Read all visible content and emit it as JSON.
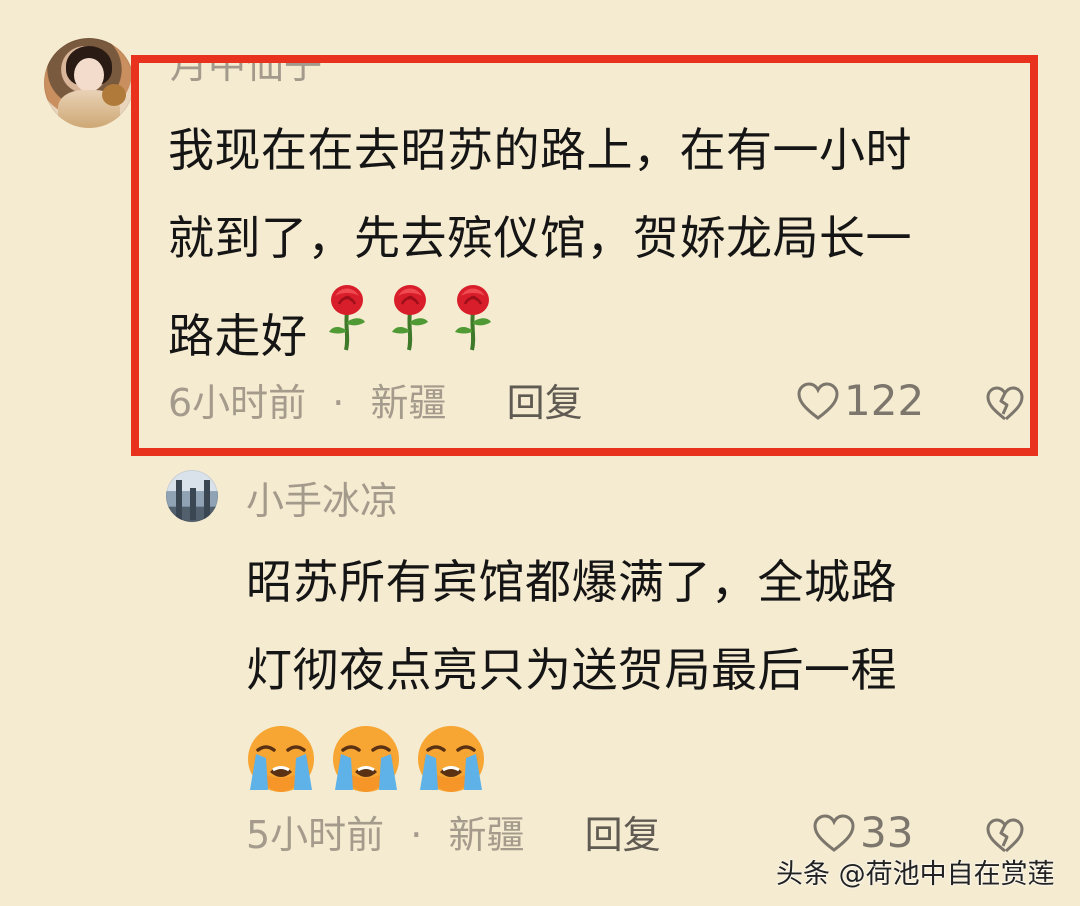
{
  "comments": [
    {
      "username": "月中仙子",
      "text_lines": [
        "我现在在去昭苏的路上，在有一小时",
        "就到了，先去殡仪馆，贺娇龙局长一",
        "路走好"
      ],
      "emoji": "🌹",
      "time": "6小时前",
      "separator": "·",
      "location": "新疆",
      "reply_label": "回复",
      "likes": "122",
      "avatar_icon": "user-avatar-woman-icon",
      "highlighted": true,
      "highlight_color": "#e8321e"
    },
    {
      "username": "小手冰凉",
      "text_lines": [
        "昭苏所有宾馆都爆满了，全城路",
        "灯彻夜点亮只为送贺局最后一程"
      ],
      "emoji": "😭",
      "time": "5小时前",
      "separator": "·",
      "location": "新疆",
      "reply_label": "回复",
      "likes": "33",
      "avatar_icon": "user-avatar-building-icon",
      "highlighted": false
    }
  ],
  "watermark": "头条 @荷池中自在赏莲",
  "icons": {
    "like": "heart-outline-icon",
    "dislike": "broken-heart-icon"
  },
  "colors": {
    "background": "#f5ebd0",
    "highlight": "#e8321e",
    "meta_text": "#a59b8c",
    "body_text": "#151515"
  }
}
